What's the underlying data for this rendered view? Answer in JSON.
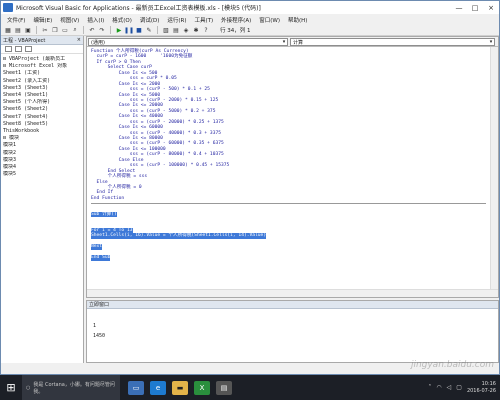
{
  "window": {
    "title": "Microsoft Visual Basic for Applications - 最新员工Excel工资表模板.xls - [模块5 (代码)]",
    "minimize": "—",
    "maximize": "□",
    "close": "×"
  },
  "menu": [
    "文件(F)",
    "编辑(E)",
    "视图(V)",
    "插入(I)",
    "格式(O)",
    "调试(D)",
    "运行(R)",
    "工具(T)",
    "外接程序(A)",
    "窗口(W)",
    "帮助(H)"
  ],
  "toolbar": {
    "position": "行 34，列 1"
  },
  "project_pane": {
    "title": "工程 - VBAProject",
    "close": "×",
    "tree": [
      "⊟ VBAProject (最新员工",
      "  ⊟ Microsoft Excel 对象",
      "    Sheet1 (工资)",
      "    Sheet2 (录入工资)",
      "    Sheet3 (Sheet3)",
      "    Sheet4 (Sheet1)",
      "    Sheet5 (个人所得)",
      "    Sheet6 (Sheet2)",
      "    Sheet7 (Sheet4)",
      "    Sheet8 (Sheet5)",
      "    ThisWorkbook",
      "  ⊟ 模块",
      "    模块1",
      "    模块2",
      "    模块3",
      "    模块4",
      "    模块5"
    ]
  },
  "editor": {
    "object_combo": "(通用)",
    "proc_combo": "计算",
    "code_lines": [
      "Function 个人所得税(curP As Currency)",
      "  curP = curP - 1600     '1600为免征额",
      "  If curP > 0 Then",
      "      Select Case curP",
      "          Case Is <= 500",
      "              sss = curP * 0.05",
      "          Case Is <= 2000",
      "              sss = (curP - 500) * 0.1 + 25",
      "          Case Is <= 5000",
      "              sss = (curP - 2000) * 0.15 + 125",
      "          Case Is <= 20000",
      "              sss = (curP - 5000) * 0.2 + 375",
      "          Case Is <= 40000",
      "              sss = (curP - 20000) * 0.25 + 1375",
      "          Case Is <= 60000",
      "              sss = (curP - 40000) * 0.3 + 3375",
      "          Case Is <= 80000",
      "              sss = (curP - 60000) * 0.35 + 6375",
      "          Case Is <= 100000",
      "              sss = (curP - 80000) * 0.4 + 10375",
      "          Case Else",
      "              sss = (curP - 100000) * 0.45 + 15375",
      "      End Select",
      "      个人所得税 = sss",
      "  Else",
      "      个人所得税 = 0",
      "  End If",
      "End Function"
    ],
    "selected_lines": [
      "Sub 计算()",
      "",
      "",
      "For i = 4 To 13",
      "Sheet1.Cells(i, 16).Value = 个人所得税(Sheet1.Cells(i, 14).Value)",
      "",
      "Next",
      "",
      "End Sub"
    ]
  },
  "immediate": {
    "title": "立即窗口",
    "lines": [
      "1",
      "1450"
    ]
  },
  "taskbar": {
    "search_placeholder": "我是 Cortana，小娜。有问题尽管问我。",
    "time": "10:16",
    "date": "2016-07-26",
    "watermark": "jingyan.baidu.com"
  }
}
